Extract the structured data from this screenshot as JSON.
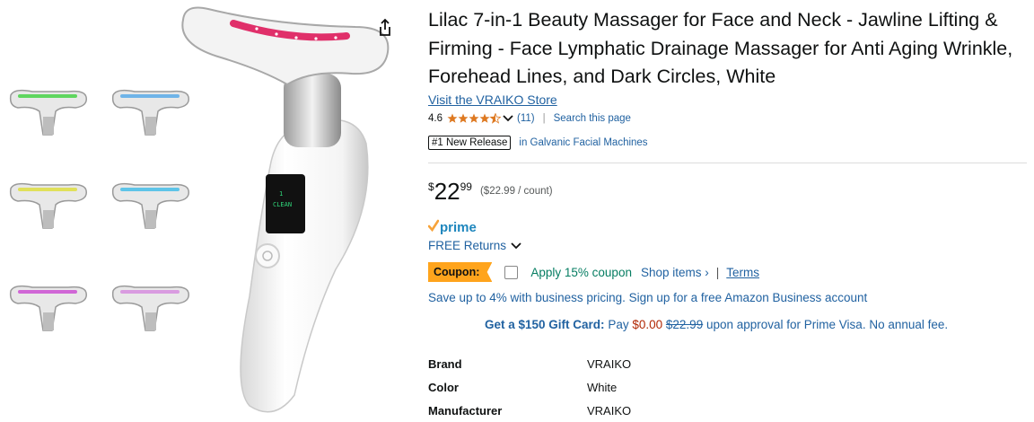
{
  "product": {
    "title": "Lilac 7-in-1 Beauty Massager for Face and Neck - Jawline Lifting & Firming - Face Lymphatic Drainage Massager for Anti Aging Wrinkle, Forehead Lines, and Dark Circles, White",
    "store_link": "Visit the VRAIKO Store",
    "rating_value": "4.6",
    "rating_count": "(11)",
    "search_link": "Search this page",
    "badge": "#1 New Release",
    "badge_category": "in Galvanic Facial Machines"
  },
  "price": {
    "symbol": "$",
    "whole": "22",
    "fraction": "99",
    "per_unit": "($22.99 / count)"
  },
  "delivery": {
    "prime_label": "prime",
    "returns_label": "FREE Returns"
  },
  "coupon": {
    "badge": "Coupon:",
    "apply_text": "Apply 15% coupon",
    "shop_items": "Shop items ›",
    "separator": "|",
    "terms": "Terms"
  },
  "business_text": "Save up to 4% with business pricing. Sign up for a free Amazon Business account",
  "gift": {
    "bold": "Get a $150 Gift Card:",
    "pay": "Pay",
    "new_price": "$0.00",
    "old_price": "$22.99",
    "rest": "upon approval for Prime Visa. No annual fee."
  },
  "specs": [
    {
      "key": "Brand",
      "value": "VRAIKO"
    },
    {
      "key": "Color",
      "value": "White"
    },
    {
      "key": "Manufacturer",
      "value": "VRAIKO"
    }
  ],
  "thumbnails": [
    {
      "glow": "#5fd65f"
    },
    {
      "glow": "#6fb4e8"
    },
    {
      "glow": "#e0e05a"
    },
    {
      "glow": "#5ec4e8"
    },
    {
      "glow": "#d066d6"
    },
    {
      "glow": "#d99be0"
    }
  ],
  "icons": {
    "share": "share-icon",
    "chevron": "chevron-down-icon",
    "prime_check": "prime-check-icon"
  },
  "device_screen": {
    "line1": "1",
    "line2": "CLEAN"
  },
  "colors": {
    "link": "#2162a1",
    "coupon_badge": "#ffa41c",
    "apply_green": "#067d62",
    "price_red": "#b12704",
    "star": "#de7921",
    "prime_blue": "#1e86bd"
  }
}
